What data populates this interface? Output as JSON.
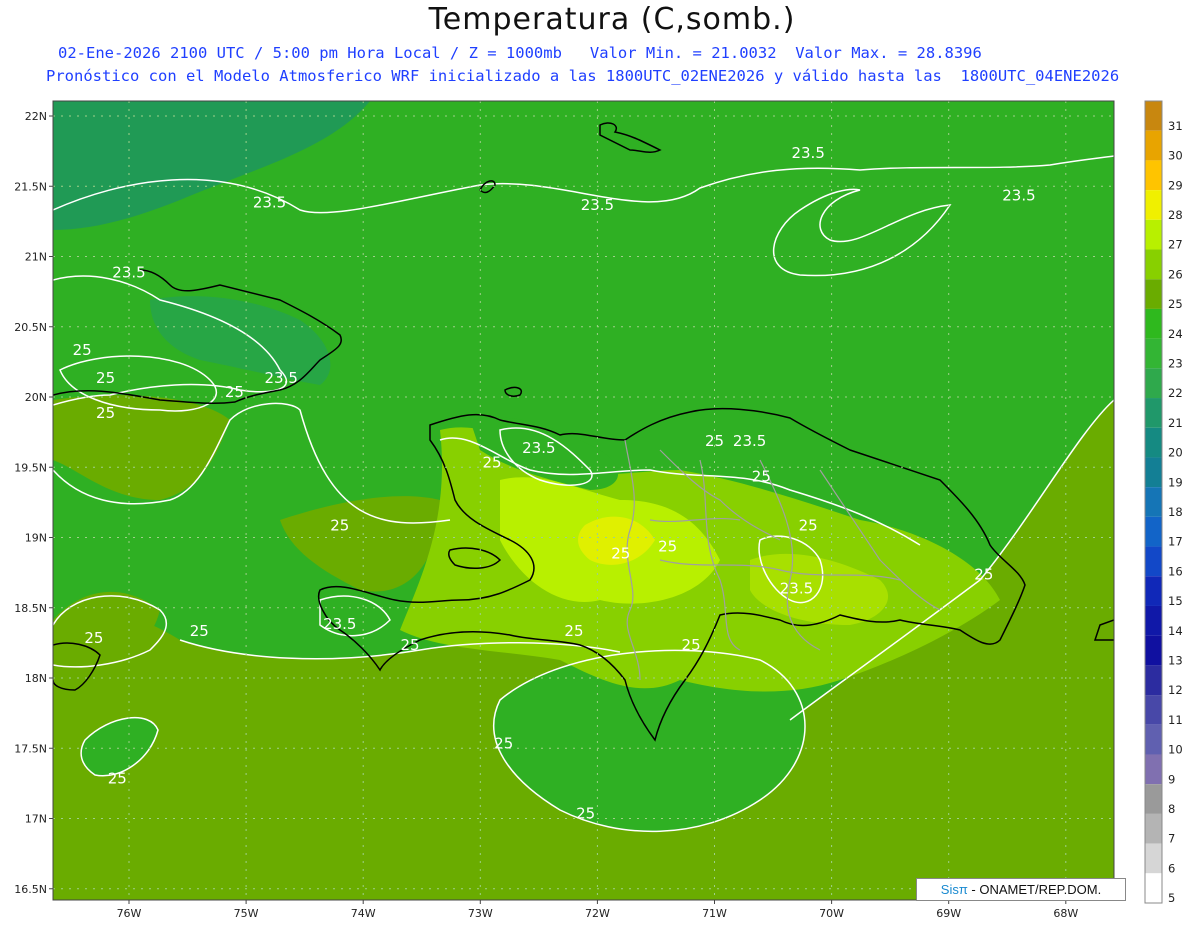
{
  "header": {
    "title": "Temperatura (C,somb.)",
    "line1": "02-Ene-2026 2100 UTC / 5:00 pm Hora Local / Z = 1000mb   Valor Min. = 21.0032  Valor Max. = 28.8396",
    "line2": "Pronóstico con el Modelo Atmosferico WRF inicializado a las 1800UTC_02ENE2026 y válido hasta las  1800UTC_04ENE2026"
  },
  "axes": {
    "lat_labels": [
      "22N",
      "21.5N",
      "21N",
      "20.5N",
      "20N",
      "19.5N",
      "19N",
      "18.5N",
      "18N",
      "17.5N",
      "17N",
      "16.5N"
    ],
    "lon_labels": [
      "76W",
      "75W",
      "74W",
      "73W",
      "72W",
      "71W",
      "70W",
      "69W",
      "68W"
    ]
  },
  "contour_labels": [
    {
      "text": "23.5",
      "lon": -74.8,
      "lat": 21.35
    },
    {
      "text": "23.5",
      "lon": -72.0,
      "lat": 21.33
    },
    {
      "text": "23.5",
      "lon": -70.2,
      "lat": 21.7
    },
    {
      "text": "23.5",
      "lon": -68.4,
      "lat": 21.4
    },
    {
      "text": "23.5",
      "lon": -76.0,
      "lat": 20.85
    },
    {
      "text": "23.5",
      "lon": -74.7,
      "lat": 20.1
    },
    {
      "text": "23.5",
      "lon": -72.5,
      "lat": 19.6
    },
    {
      "text": "23.5",
      "lon": -70.7,
      "lat": 19.65
    },
    {
      "text": "23.5",
      "lon": -70.3,
      "lat": 18.6
    },
    {
      "text": "23.5",
      "lon": -74.2,
      "lat": 18.35
    },
    {
      "text": "25",
      "lon": -76.4,
      "lat": 20.3
    },
    {
      "text": "25",
      "lon": -76.2,
      "lat": 20.1
    },
    {
      "text": "25",
      "lon": -75.1,
      "lat": 20.0
    },
    {
      "text": "25",
      "lon": -76.2,
      "lat": 19.85
    },
    {
      "text": "25",
      "lon": -74.2,
      "lat": 19.05
    },
    {
      "text": "25",
      "lon": -72.9,
      "lat": 19.5
    },
    {
      "text": "25",
      "lon": -71.0,
      "lat": 19.65
    },
    {
      "text": "25",
      "lon": -70.6,
      "lat": 19.4
    },
    {
      "text": "25",
      "lon": -70.2,
      "lat": 19.05
    },
    {
      "text": "25",
      "lon": -71.4,
      "lat": 18.9
    },
    {
      "text": "25",
      "lon": -71.8,
      "lat": 18.85
    },
    {
      "text": "25",
      "lon": -72.2,
      "lat": 18.3
    },
    {
      "text": "25",
      "lon": -71.2,
      "lat": 18.2
    },
    {
      "text": "25",
      "lon": -73.6,
      "lat": 18.2
    },
    {
      "text": "25",
      "lon": -75.4,
      "lat": 18.3
    },
    {
      "text": "25",
      "lon": -76.3,
      "lat": 18.25
    },
    {
      "text": "25",
      "lon": -72.8,
      "lat": 17.5
    },
    {
      "text": "25",
      "lon": -76.1,
      "lat": 17.25
    },
    {
      "text": "25",
      "lon": -72.1,
      "lat": 17.0
    },
    {
      "text": "25",
      "lon": -68.7,
      "lat": 18.7
    }
  ],
  "colorbar": {
    "labels": [
      "31",
      "30",
      "29",
      "28",
      "27",
      "26",
      "25",
      "24",
      "23",
      "22",
      "21",
      "20",
      "19",
      "18",
      "17",
      "16",
      "15",
      "14",
      "13",
      "12",
      "11",
      "10",
      "9",
      "8",
      "7",
      "6",
      "5"
    ],
    "colors": [
      "#c8870f",
      "#e8a400",
      "#ffc400",
      "#f0f000",
      "#b8f000",
      "#88d000",
      "#6aac00",
      "#2fb91e",
      "#33b534",
      "#2fa94c",
      "#20986a",
      "#158a82",
      "#137f95",
      "#1575b6",
      "#1264c8",
      "#1248c8",
      "#1028b8",
      "#1018a8",
      "#1010a0",
      "#2c2ca0",
      "#4848a8",
      "#6060b0",
      "#8070b0",
      "#9a9a9a",
      "#b4b4b4",
      "#d6d6d6",
      "#ffffff"
    ]
  },
  "palette": {
    "ocean_main": "#2fb023",
    "warm_sea": "#6aac00",
    "cool_nw": "#209a55",
    "land_warm": "#88d000",
    "hot": "#e0f000",
    "contour": "#ffffff",
    "coast": "#000000",
    "provinces": "#a0a0a0"
  },
  "credit": {
    "brand": "Sisπ",
    "text": " - ONAMET/REP.DOM."
  }
}
